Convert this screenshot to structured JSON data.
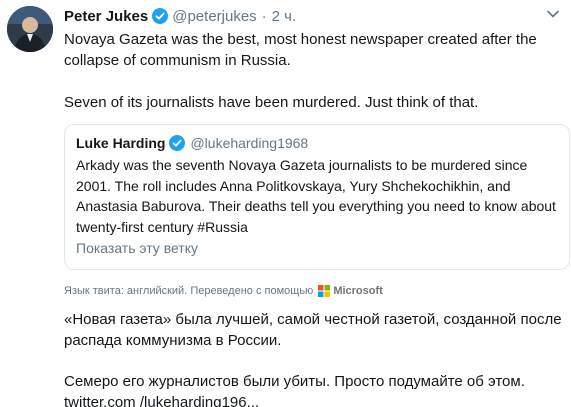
{
  "author": {
    "display_name": "Peter Jukes",
    "handle": "@peterjukes",
    "separator": "·",
    "timestamp": "2 ч."
  },
  "tweet": {
    "paragraph_1": "Novaya Gazeta was the best, most honest newspaper created after the collapse of communism in Russia.",
    "paragraph_2": "Seven of its journalists have been murdered. Just think of that."
  },
  "quoted_tweet": {
    "display_name": "Luke Harding",
    "handle": "@lukeharding1968",
    "text": "Arkady was the seventh Novaya Gazeta journalists to be murdered since 2001. The roll includes Anna Politkovskaya, Yury Shchekochikhin, and Anastasia Baburova. Their deaths tell you everything you need to know about twenty-first century #Russia",
    "show_thread": "Показать эту ветку"
  },
  "translation": {
    "note": "Язык твита: английский. Переведено с помощью",
    "provider": "Microsoft",
    "paragraph_1": "«Новая газета» была лучшей, самой честной газетой, созданной после распада коммунизма в России.",
    "paragraph_2": "Семеро его журналистов были убиты. Просто подумайте об этом. twitter.com /lukeharding196..."
  },
  "icons": {
    "verified": "verified-badge-icon",
    "more": "chevron-down-icon",
    "provider_logo": "microsoft-logo-icon"
  },
  "colors": {
    "verified_blue": "#1da1f2",
    "secondary_text": "#657786",
    "border": "#e1e8ed"
  }
}
